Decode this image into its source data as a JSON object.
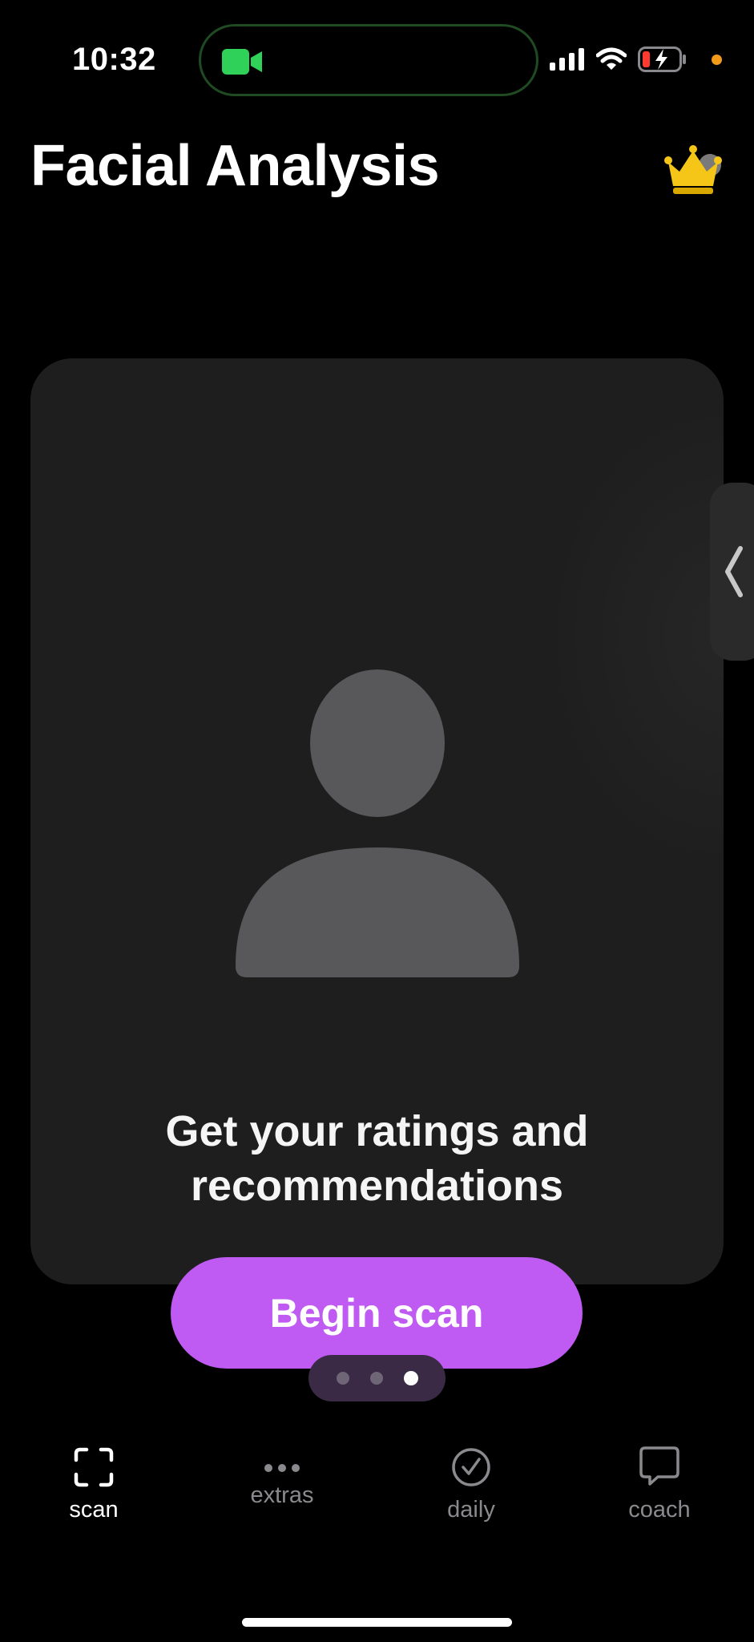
{
  "status_bar": {
    "time": "10:32"
  },
  "header": {
    "title": "Facial Analysis",
    "premium_icon": "crown-icon"
  },
  "card": {
    "line1": "Get your ratings and",
    "line2": "recommendations"
  },
  "primary_action": {
    "label": "Begin scan"
  },
  "pager": {
    "count": 3,
    "active_index": 2
  },
  "tabs": [
    {
      "label": "scan",
      "icon": "scan-frame-icon",
      "active": true
    },
    {
      "label": "extras",
      "icon": "ellipsis-icon",
      "active": false
    },
    {
      "label": "daily",
      "icon": "checkmark-circle-icon",
      "active": false
    },
    {
      "label": "coach",
      "icon": "chat-bubble-icon",
      "active": false
    }
  ],
  "colors": {
    "accent": "#bf5af2",
    "card": "#1e1e1e",
    "background": "#000000",
    "inactive_tab": "#8a8a8e",
    "camera_indicator": "#30d158",
    "crown": "#f5c518"
  }
}
